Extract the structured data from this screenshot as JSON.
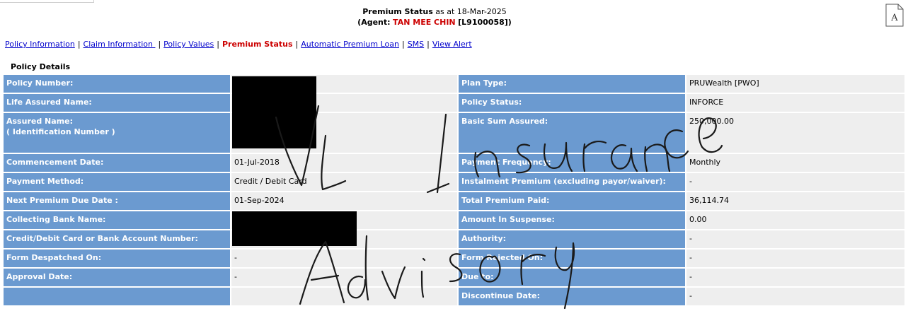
{
  "header": {
    "title": "Premium Status",
    "as_at_prefix": "as at",
    "as_at_date": "18-Mar-2025",
    "agent_prefix": "(Agent:",
    "agent_name": "TAN MEE CHIN",
    "agent_code": "[L9100058]",
    "agent_suffix": ")"
  },
  "nav": {
    "links": [
      "Policy Information",
      "Claim Information ",
      "Policy Values",
      "Premium Status",
      "Automatic Premium Loan",
      "SMS",
      "View Alert"
    ],
    "active_index": 3
  },
  "section": {
    "title": "Policy Details"
  },
  "rows": [
    {
      "l1": "Policy Number:",
      "v1": "",
      "l2": "Plan Type:",
      "v2": "PRUWealth [PWO]"
    },
    {
      "l1": "Life Assured Name:",
      "v1": "",
      "l2": "Policy Status:",
      "v2": "INFORCE"
    },
    {
      "l1": "Assured Name:",
      "l1b": "( Identification Number )",
      "v1": "",
      "l2": "Basic Sum Assured:",
      "v2": "250,000.00"
    },
    {
      "l1": "Commencement Date:",
      "v1": "01-Jul-2018",
      "l2": "Payment Frequency:",
      "v2": "Monthly"
    },
    {
      "l1": "Payment Method:",
      "v1": "Credit / Debit Card",
      "l2": "Instalment Premium (excluding payor/waiver):",
      "v2": "-"
    },
    {
      "l1": "Next Premium Due Date :",
      "v1": "01-Sep-2024",
      "l2": "Total Premium Paid:",
      "v2": "36,114.74"
    },
    {
      "l1": "Collecting Bank Name:",
      "v1": "",
      "l2": "Amount In Suspense:",
      "v2": "0.00"
    },
    {
      "l1": "Credit/Debit Card or Bank Account Number:",
      "v1": "",
      "l2": "Authority:",
      "v2": "-"
    },
    {
      "l1": "Form Despatched On:",
      "v1": "-",
      "l2": "Form Rejected On:",
      "v2": "-"
    },
    {
      "l1": "Approval Date:",
      "v1": "-",
      "l2": "Due to:",
      "v2": "-"
    },
    {
      "l1": "",
      "v1": "",
      "l2": "Discontinue Date:",
      "v2": "-"
    }
  ],
  "watermark": {
    "line1": "VL Insurance",
    "line2": "Advisory"
  },
  "colors": {
    "label_bg": "#6b9ad0",
    "value_bg": "#eeeeee",
    "agent_red": "#cc0000",
    "link_blue": "#0000cc"
  },
  "icons": {
    "document": "document-a-icon"
  }
}
